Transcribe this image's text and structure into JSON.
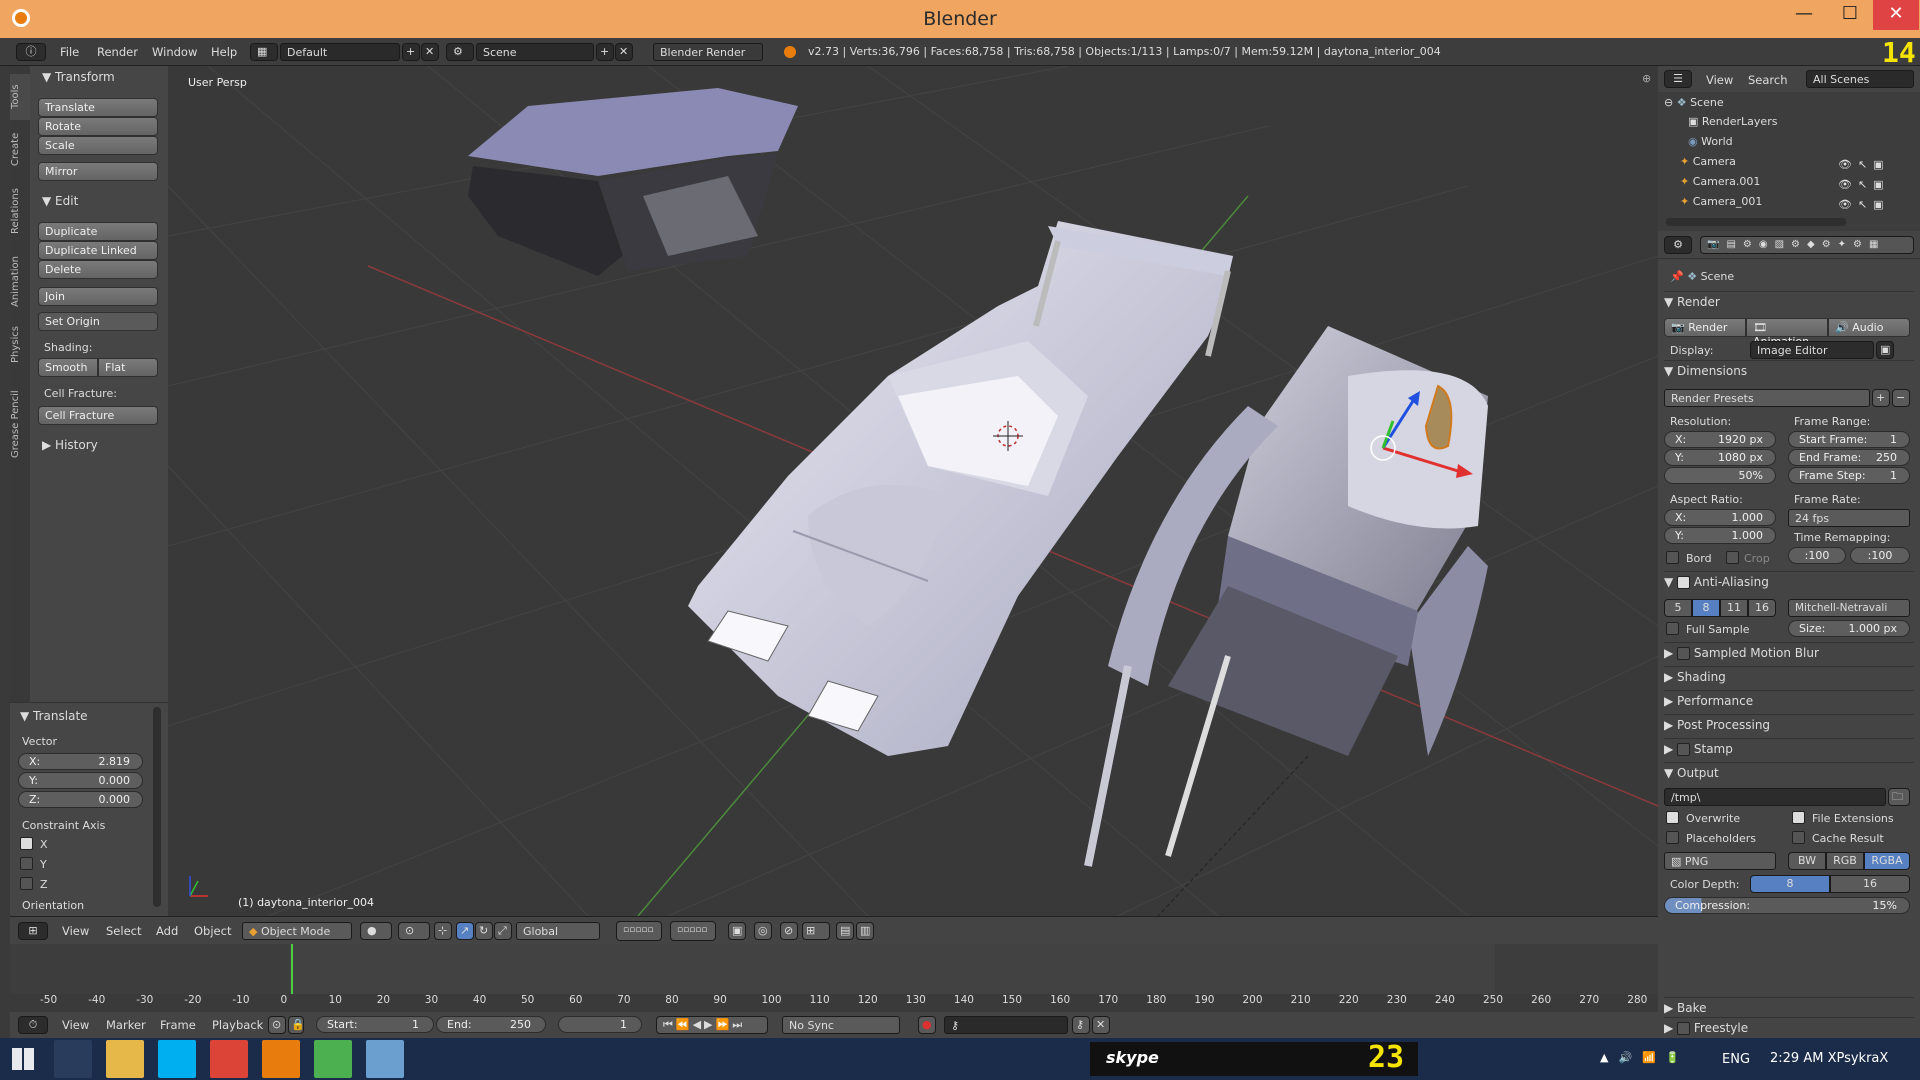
{
  "window": {
    "title": "Blender",
    "minimize": "—",
    "maximize": "☐",
    "close": "✕"
  },
  "infobar": {
    "menus": [
      "File",
      "Render",
      "Window",
      "Help"
    ],
    "layout": "Default",
    "scene": "Scene",
    "engine": "Blender Render",
    "stats": "v2.73 | Verts:36,796 | Faces:68,758 | Tris:68,758 | Objects:1/113 | Lamps:0/7 | Mem:59.12M | daytona_interior_004",
    "fps_overlay": "14"
  },
  "toolshelf": {
    "tabs": [
      "Tools",
      "Create",
      "Relations",
      "Animation",
      "Physics",
      "Grease Pencil"
    ],
    "transform_header": "Transform",
    "transform_buttons": [
      "Translate",
      "Rotate",
      "Scale"
    ],
    "mirror": "Mirror",
    "edit_header": "Edit",
    "edit_buttons": [
      "Duplicate",
      "Duplicate Linked",
      "Delete"
    ],
    "join": "Join",
    "set_origin": "Set Origin",
    "shading_label": "Shading:",
    "smooth": "Smooth",
    "flat": "Flat",
    "cell_fracture_label": "Cell Fracture:",
    "cell_fracture_btn": "Cell Fracture",
    "history": "History"
  },
  "operator": {
    "header": "Translate",
    "vector_label": "Vector",
    "x": "X:",
    "x_val": "2.819",
    "y": "Y:",
    "y_val": "0.000",
    "z": "Z:",
    "z_val": "0.000",
    "constraint_label": "Constraint Axis",
    "axes": [
      "X",
      "Y",
      "Z"
    ],
    "orientation": "Orientation"
  },
  "viewport": {
    "label": "User Persp",
    "object_label": "(1) daytona_interior_004"
  },
  "viewheader": {
    "menus": [
      "View",
      "Select",
      "Add",
      "Object"
    ],
    "mode": "Object Mode",
    "orientation": "Global"
  },
  "timeline": {
    "ticks": [
      "-50",
      "-40",
      "-30",
      "-20",
      "-10",
      "0",
      "10",
      "20",
      "30",
      "40",
      "50",
      "60",
      "70",
      "80",
      "90",
      "100",
      "110",
      "120",
      "130",
      "140",
      "150",
      "160",
      "170",
      "180",
      "190",
      "200",
      "210",
      "220",
      "230",
      "240",
      "250",
      "260",
      "270",
      "280"
    ],
    "menus": [
      "View",
      "Marker",
      "Frame",
      "Playback"
    ],
    "start_label": "Start:",
    "start": "1",
    "end_label": "End:",
    "end": "250",
    "current": "1",
    "sync": "No Sync"
  },
  "outliner": {
    "menus": [
      "View",
      "Search"
    ],
    "scenes": "All Scenes",
    "items": [
      "Scene",
      "RenderLayers",
      "World",
      "Camera",
      "Camera.001",
      "Camera_001"
    ]
  },
  "properties": {
    "context": "Scene",
    "render_header": "Render",
    "render_btns": [
      "Render",
      "Animation",
      "Audio"
    ],
    "display_label": "Display:",
    "display": "Image Editor",
    "dimensions": "Dimensions",
    "presets": "Render Presets",
    "resolution": "Resolution:",
    "res_x": "1920 px",
    "res_y": "1080 px",
    "res_pct": "50%",
    "frame_range": "Frame Range:",
    "start_frame": "Start Frame:",
    "start_val": "1",
    "end_frame": "End Frame:",
    "end_val": "250",
    "frame_step": "Frame Step:",
    "step_val": "1",
    "aspect": "Aspect Ratio:",
    "asp_x": "1.000",
    "asp_y": "1.000",
    "frame_rate": "Frame Rate:",
    "fps": "24 fps",
    "time_remap": "Time Remapping:",
    "remap_old": ":100",
    "remap_new": ":100",
    "bord": "Bord",
    "crop": "Crop",
    "anti_aliasing": "Anti-Aliasing",
    "aa_samples": [
      "5",
      "8",
      "11",
      "16"
    ],
    "filter": "Mitchell-Netravali",
    "full_sample": "Full Sample",
    "size_label": "Size:",
    "size_val": "1.000 px",
    "panels": [
      "Sampled Motion Blur",
      "Shading",
      "Performance",
      "Post Processing",
      "Stamp",
      "Output"
    ],
    "output_path": "/tmp\\",
    "overwrite": "Overwrite",
    "file_ext": "File Extensions",
    "placeholders": "Placeholders",
    "cache": "Cache Result",
    "format": "PNG",
    "color_modes": [
      "BW",
      "RGB",
      "RGBA"
    ],
    "color_depth": "Color Depth:",
    "depth_8": "8",
    "depth_16": "16",
    "compression": "Compression:",
    "compression_val": "15%",
    "bake": "Bake",
    "freestyle": "Freestyle"
  },
  "taskbar": {
    "lang": "ENG",
    "clock": "2:29 AM XPsykraX",
    "skype": "skype",
    "overlay": "23"
  }
}
